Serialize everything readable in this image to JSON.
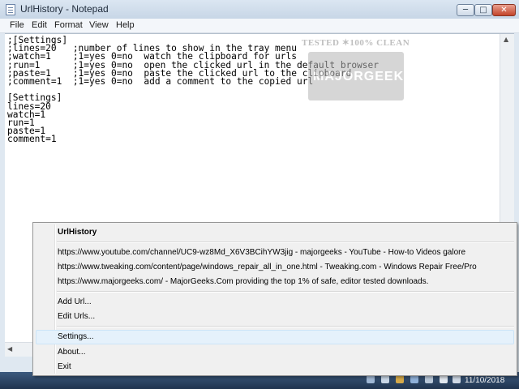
{
  "window": {
    "title": "UrlHistory - Notepad",
    "controls": {
      "minimize": "─",
      "maximize": "□",
      "close": "✕"
    }
  },
  "menubar": [
    "File",
    "Edit",
    "Format",
    "View",
    "Help"
  ],
  "editor": {
    "lines": [
      ";[Settings]",
      ";lines=20   ;number of lines to show in the tray menu",
      ";watch=1    ;1=yes 0=no  watch the clipboard for urls",
      ";run=1      ;1=yes 0=no  open the clicked url in the default browser",
      ";paste=1    ;1=yes 0=no  paste the clicked url to the clipboard",
      ";comment=1  ;1=yes 0=no  add a comment to the copied url",
      "",
      "[Settings]",
      "lines=20",
      "watch=1",
      "run=1",
      "paste=1",
      "comment=1"
    ]
  },
  "watermark": {
    "line1": "TESTED ✶100% CLEAN",
    "logo": "MAJORGEEKS"
  },
  "context_menu": {
    "title": "UrlHistory",
    "urls": [
      "https://www.youtube.com/channel/UC9-wz8Md_X6V3BCihYW3jig - majorgeeks - YouTube - How-to Videos galore",
      "https://www.tweaking.com/content/page/windows_repair_all_in_one.html - Tweaking.com - Windows Repair Free/Pro",
      "https://www.majorgeeks.com/ - MajorGeeks.Com providing the top 1% of safe, editor tested downloads."
    ],
    "add_url": "Add Url...",
    "edit_urls": "Edit Urls...",
    "settings": "Settings...",
    "about": "About...",
    "exit": "Exit"
  },
  "taskbar": {
    "clock_date": "11/10/2018"
  },
  "colors": {
    "highlight": "#e5f1fb",
    "taskbar": "#2a4262",
    "close_button": "#c3442a"
  }
}
